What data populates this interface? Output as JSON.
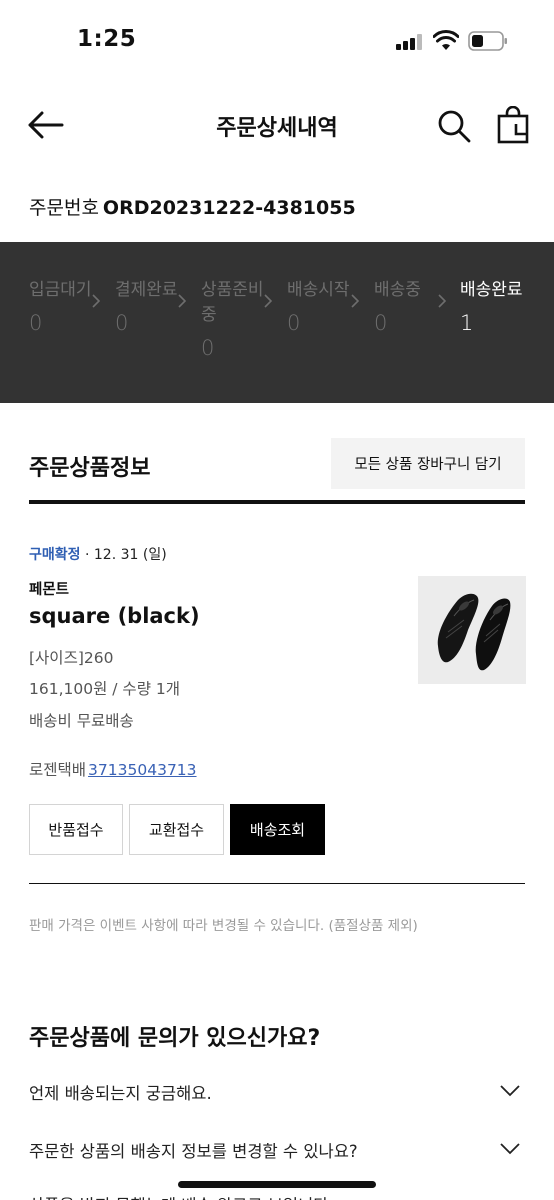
{
  "status_bar": {
    "time": "1:25"
  },
  "header": {
    "title": "주문상세내역"
  },
  "order": {
    "number_label": "주문번호",
    "number": "ORD20231222-4381055"
  },
  "progress": {
    "steps": [
      {
        "label": "입금대기",
        "count": "0"
      },
      {
        "label": "결제완료",
        "count": "0"
      },
      {
        "label": "상품준비중",
        "count": "0"
      },
      {
        "label": "배송시작",
        "count": "0"
      },
      {
        "label": "배송중",
        "count": "0"
      },
      {
        "label": "배송완료",
        "count": "1"
      }
    ],
    "active_index": 5
  },
  "product_section": {
    "title": "주문상품정보",
    "cart_all_label": "모든 상품 장바구니 담기"
  },
  "product": {
    "status": "구매확정",
    "date": "· 12. 31 (일)",
    "brand": "페몬트",
    "name": "square (black)",
    "option": "[사이즈]260",
    "price_qty": "161,100원 / 수량 1개",
    "shipping_fee": "배송비 무료배송",
    "courier": "로젠택배",
    "tracking_number": "37135043713",
    "thumbnail_icon": "shoes-photo"
  },
  "actions": {
    "return_label": "반품접수",
    "exchange_label": "교환접수",
    "track_label": "배송조회"
  },
  "notice": "판매 가격은 이벤트 사항에 따라 변경될 수 있습니다. (품절상품 제외)",
  "faq": {
    "title": "주문상품에 문의가 있으신가요?",
    "items": [
      "언제 배송되는지 궁금해요.",
      "주문한 상품의 배송지 정보를 변경할 수 있나요?",
      "상품을 받지 못했는데 배송 완료로 보입니다."
    ]
  },
  "colors": {
    "progress_bg": "#333333",
    "accent_blue": "#2f5fb3",
    "link_blue": "#3a62b5"
  }
}
